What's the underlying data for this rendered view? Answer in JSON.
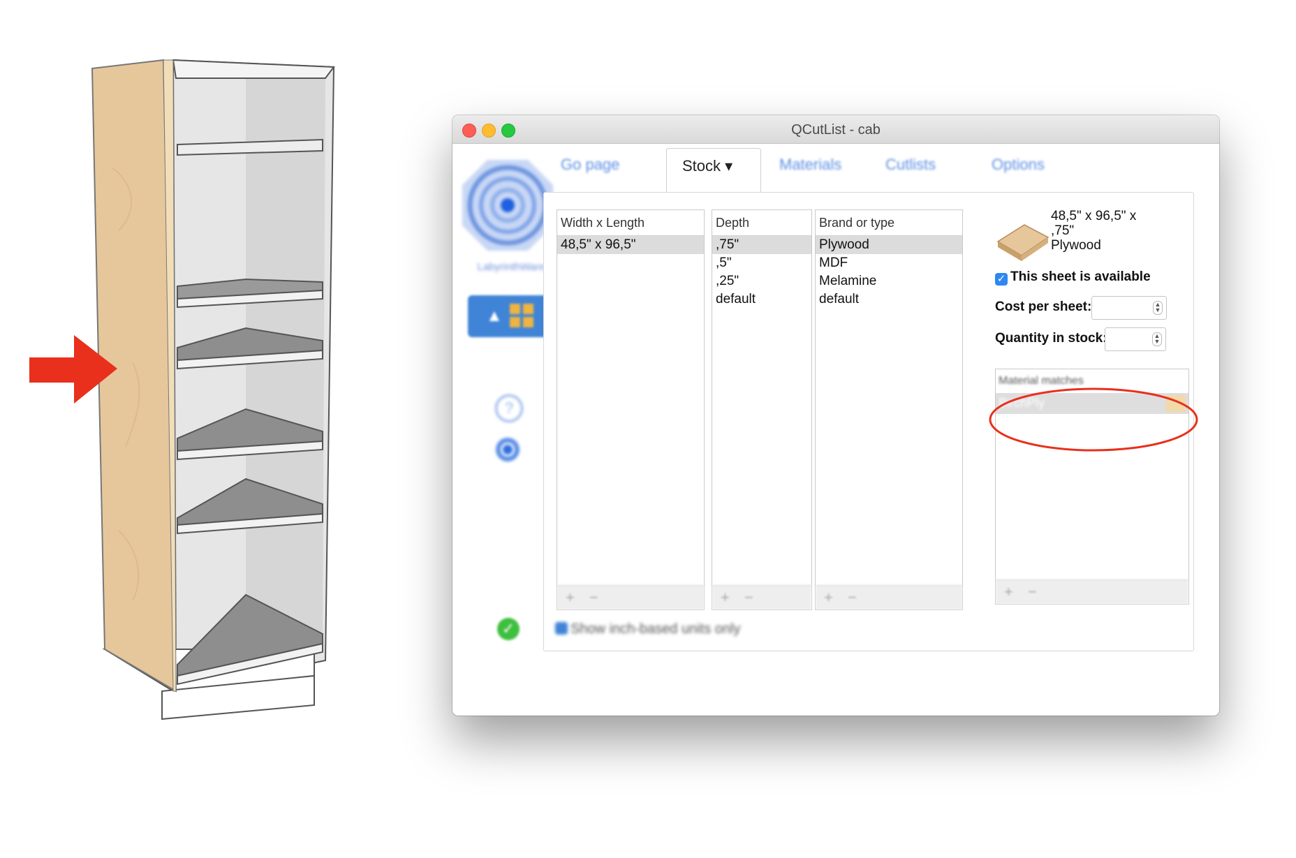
{
  "window": {
    "title": "QCutList - cab"
  },
  "tabs": [
    {
      "label": "Go page"
    },
    {
      "label": "Stock ▾"
    },
    {
      "label": "Materials"
    },
    {
      "label": "Cutlists"
    },
    {
      "label": "Options"
    }
  ],
  "sidebar": {
    "logo_caption": "LabyrinthWare"
  },
  "lists": {
    "size": {
      "header": "Width x Length",
      "items": [
        "48,5\" x 96,5\""
      ]
    },
    "depth": {
      "header": "Depth",
      "items": [
        ",75\"",
        ",5\"",
        ",25\"",
        "default"
      ]
    },
    "brand": {
      "header": "Brand or type",
      "items": [
        "Plywood",
        "MDF",
        "Melamine",
        "default"
      ]
    }
  },
  "detail": {
    "sheet_line1": "48,5\" x 96,5\" x",
    "sheet_line2": ",75\"",
    "sheet_line3": "Plywood",
    "available_label": "This sheet is available",
    "available_checked": true,
    "cost_label": "Cost per sheet:",
    "cost_value": "",
    "quantity_label": "Quantity in stock:",
    "quantity_value": "",
    "matches_header": "Material matches",
    "matches": [
      {
        "name": "BirchPly",
        "swatch": "#f2d9a8"
      }
    ]
  },
  "footer": {
    "inch_units_label": "Show inch-based units only"
  },
  "colors": {
    "annotation_red": "#e8301c",
    "tab_blue": "#5d90e5",
    "plywood": "#e6c79b"
  }
}
